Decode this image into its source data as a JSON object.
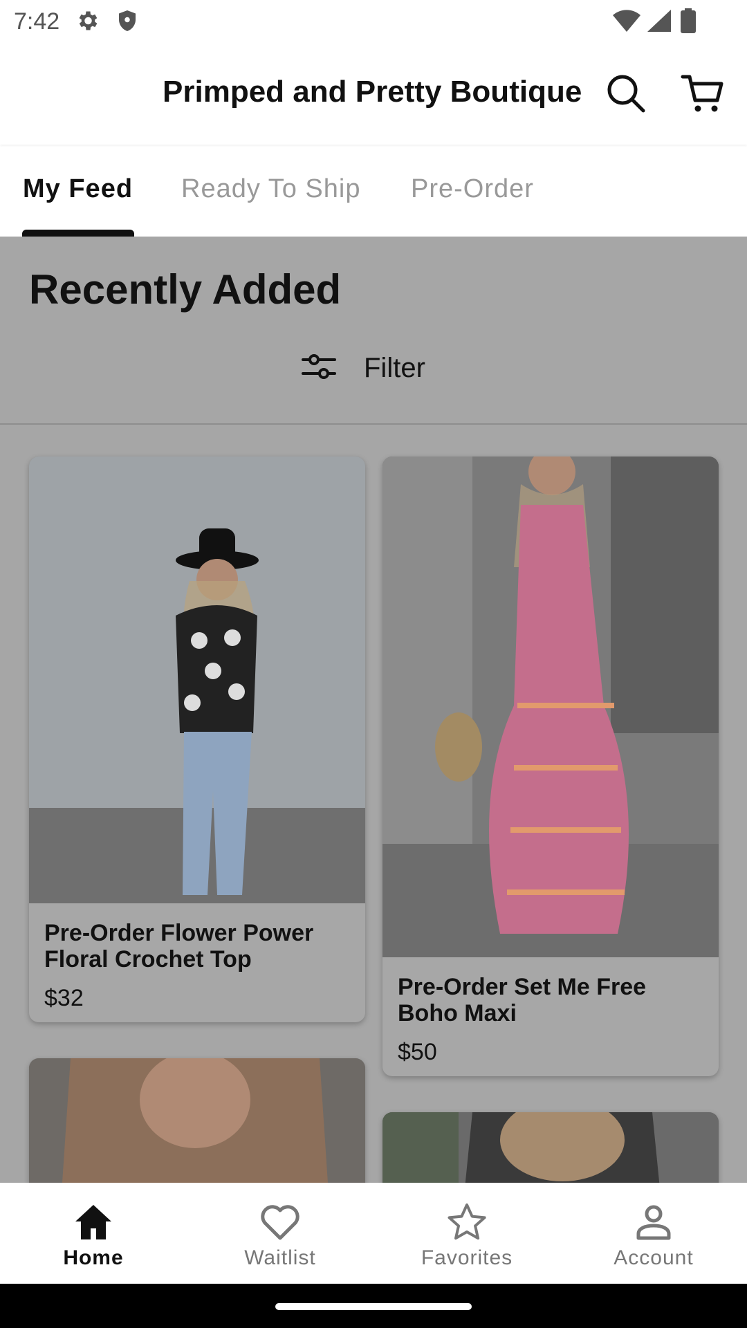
{
  "status_bar": {
    "time": "7:42",
    "left_icons": [
      "gear-icon",
      "shield-icon"
    ],
    "right_icons": [
      "wifi-icon",
      "signal-icon",
      "battery-icon"
    ]
  },
  "header": {
    "title": "Primped and Pretty Boutique",
    "actions": [
      "search-icon",
      "cart-icon"
    ]
  },
  "tabs": [
    {
      "label": "My Feed",
      "active": true
    },
    {
      "label": "Ready To Ship",
      "active": false
    },
    {
      "label": "Pre-Order",
      "active": false
    }
  ],
  "main": {
    "section_title": "Recently Added",
    "filter_label": "Filter",
    "products": [
      {
        "name": "Pre-Order Flower Power Floral Crochet Top",
        "price": "$32"
      },
      {
        "name": "Pre-Order Set Me Free Boho Maxi",
        "price": "$50"
      }
    ]
  },
  "bottom_nav": [
    {
      "label": "Home",
      "icon": "home-icon",
      "active": true
    },
    {
      "label": "Waitlist",
      "icon": "heart-icon",
      "active": false
    },
    {
      "label": "Favorites",
      "icon": "star-icon",
      "active": false
    },
    {
      "label": "Account",
      "icon": "account-icon",
      "active": false
    }
  ],
  "colors": {
    "overlay": "#a6a6a6",
    "active_text": "#111111",
    "inactive_text": "#999999"
  }
}
